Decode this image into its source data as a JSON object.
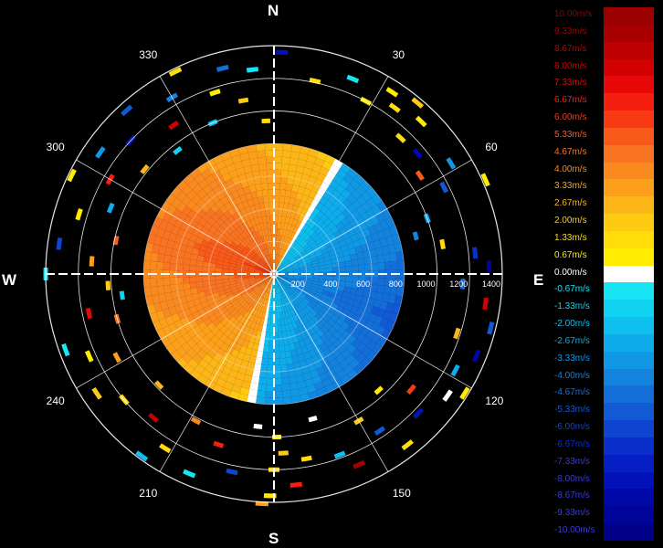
{
  "chart_data": {
    "type": "heatmap",
    "subtype": "polar radial velocity scan",
    "cardinal_labels": {
      "north": "N",
      "east": "E",
      "south": "S",
      "west": "W"
    },
    "bearing_labels": [
      "30",
      "60",
      "120",
      "150",
      "210",
      "240",
      "300",
      "330"
    ],
    "bearing_values": [
      30,
      60,
      120,
      150,
      210,
      240,
      300,
      330
    ],
    "range_labels": [
      "200",
      "400",
      "600",
      "800",
      "1000",
      "1200",
      "1400"
    ],
    "range_values": [
      200,
      400,
      600,
      800,
      1000,
      1200,
      1400
    ],
    "range_max": 1400,
    "colorbar": {
      "unit": "m/s",
      "entries": [
        {
          "label": "10.00m/s",
          "value": 10.0,
          "color": "#9a0000"
        },
        {
          "label": "9.33m/s",
          "value": 9.33,
          "color": "#a80000"
        },
        {
          "label": "8.67m/s",
          "value": 8.67,
          "color": "#bd0000"
        },
        {
          "label": "8.00m/s",
          "value": 8.0,
          "color": "#d20000"
        },
        {
          "label": "7.33m/s",
          "value": 7.33,
          "color": "#e80808"
        },
        {
          "label": "6.67m/s",
          "value": 6.67,
          "color": "#f51f10"
        },
        {
          "label": "6.00m/s",
          "value": 6.0,
          "color": "#f73a14"
        },
        {
          "label": "5.33m/s",
          "value": 5.33,
          "color": "#f85a1a"
        },
        {
          "label": "4.67m/s",
          "value": 4.67,
          "color": "#f97422"
        },
        {
          "label": "4.00m/s",
          "value": 4.0,
          "color": "#fa8a20"
        },
        {
          "label": "3.33m/s",
          "value": 3.33,
          "color": "#fca01c"
        },
        {
          "label": "2.67m/s",
          "value": 2.67,
          "color": "#fdb618"
        },
        {
          "label": "2.00m/s",
          "value": 2.0,
          "color": "#fecb12"
        },
        {
          "label": "1.33m/s",
          "value": 1.33,
          "color": "#ffdc0a"
        },
        {
          "label": "0.67m/s",
          "value": 0.67,
          "color": "#ffec00"
        },
        {
          "label": "0.00m/s",
          "value": 0.0,
          "color": "#ffffff"
        },
        {
          "label": "-0.67m/s",
          "value": -0.67,
          "color": "#17e5f4"
        },
        {
          "label": "-1.33m/s",
          "value": -1.33,
          "color": "#12d2f2"
        },
        {
          "label": "-2.00m/s",
          "value": -2.0,
          "color": "#0fc0ef"
        },
        {
          "label": "-2.67m/s",
          "value": -2.67,
          "color": "#0eacea"
        },
        {
          "label": "-3.33m/s",
          "value": -3.33,
          "color": "#1198e4"
        },
        {
          "label": "-4.00m/s",
          "value": -4.0,
          "color": "#1383de"
        },
        {
          "label": "-4.67m/s",
          "value": -4.67,
          "color": "#146ed8"
        },
        {
          "label": "-5.33m/s",
          "value": -5.33,
          "color": "#1259d4"
        },
        {
          "label": "-6.00m/s",
          "value": -6.0,
          "color": "#0e44d0"
        },
        {
          "label": "-6.67m/s",
          "value": -6.67,
          "color": "#0a30cc"
        },
        {
          "label": "-7.33m/s",
          "value": -7.33,
          "color": "#061fc4"
        },
        {
          "label": "-8.00m/s",
          "value": -8.0,
          "color": "#0212b8"
        },
        {
          "label": "-8.67m/s",
          "value": -8.67,
          "color": "#0008a8"
        },
        {
          "label": "-9.33m/s",
          "value": -9.33,
          "color": "#000498"
        },
        {
          "label": "-10.00m/s",
          "value": -10.0,
          "color": "#000088"
        }
      ]
    },
    "inner_disc": {
      "range_max": 800,
      "zero_line_bearing_north": 30,
      "zero_line_bearing_south": 190,
      "receding_sector_velocity_range": [
        2.0,
        6.0
      ],
      "approaching_sector_velocity_range": [
        -5.33,
        -1.33
      ]
    },
    "scatter_gates": [
      {
        "bearing": 2,
        "range": 1360,
        "velocity": -8.0
      },
      {
        "bearing": 12,
        "range": 1210,
        "velocity": 1.33
      },
      {
        "bearing": 22,
        "range": 1290,
        "velocity": -0.67
      },
      {
        "bearing": 28,
        "range": 1200,
        "velocity": 0.67
      },
      {
        "bearing": 33,
        "range": 1330,
        "velocity": 0.67
      },
      {
        "bearing": 36,
        "range": 1260,
        "velocity": 1.33
      },
      {
        "bearing": 40,
        "range": 1370,
        "velocity": 2.0
      },
      {
        "bearing": 44,
        "range": 1300,
        "velocity": 0.67
      },
      {
        "bearing": 43,
        "range": 1140,
        "velocity": 1.33
      },
      {
        "bearing": 50,
        "range": 1150,
        "velocity": -8.67
      },
      {
        "bearing": 56,
        "range": 1080,
        "velocity": 5.33
      },
      {
        "bearing": 58,
        "range": 1280,
        "velocity": -3.33
      },
      {
        "bearing": 63,
        "range": 1170,
        "velocity": -5.33
      },
      {
        "bearing": 66,
        "range": 1420,
        "velocity": 0.67
      },
      {
        "bearing": 70,
        "range": 1000,
        "velocity": -2.67
      },
      {
        "bearing": 75,
        "range": 900,
        "velocity": -4.0
      },
      {
        "bearing": 80,
        "range": 1050,
        "velocity": 1.33
      },
      {
        "bearing": 84,
        "range": 1240,
        "velocity": -6.67
      },
      {
        "bearing": 88,
        "range": 1320,
        "velocity": -9.33
      },
      {
        "bearing": 93,
        "range": 1160,
        "velocity": -4.67
      },
      {
        "bearing": 98,
        "range": 1310,
        "velocity": 8.0
      },
      {
        "bearing": 104,
        "range": 1370,
        "velocity": -5.33
      },
      {
        "bearing": 108,
        "range": 1180,
        "velocity": 2.67
      },
      {
        "bearing": 112,
        "range": 1340,
        "velocity": -8.67
      },
      {
        "bearing": 118,
        "range": 1260,
        "velocity": -2.67
      },
      {
        "bearing": 122,
        "range": 1380,
        "velocity": 0.67
      },
      {
        "bearing": 125,
        "range": 1300,
        "velocity": 0.0
      },
      {
        "bearing": 130,
        "range": 1100,
        "velocity": 6.0
      },
      {
        "bearing": 134,
        "range": 1230,
        "velocity": -8.0
      },
      {
        "bearing": 138,
        "range": 960,
        "velocity": 0.67
      },
      {
        "bearing": 142,
        "range": 1330,
        "velocity": 1.33
      },
      {
        "bearing": 146,
        "range": 1160,
        "velocity": -5.33
      },
      {
        "bearing": 150,
        "range": 1040,
        "velocity": 2.0
      },
      {
        "bearing": 156,
        "range": 1280,
        "velocity": 9.33
      },
      {
        "bearing": 160,
        "range": 1180,
        "velocity": -2.0
      },
      {
        "bearing": 165,
        "range": 920,
        "velocity": 0.0
      },
      {
        "bearing": 170,
        "range": 1150,
        "velocity": 1.33
      },
      {
        "bearing": 174,
        "range": 1300,
        "velocity": 6.67
      },
      {
        "bearing": 177,
        "range": 1100,
        "velocity": 2.0
      },
      {
        "bearing": 179,
        "range": 1000,
        "velocity": 0.67
      },
      {
        "bearing": 180,
        "range": 1200,
        "velocity": 1.33
      },
      {
        "bearing": 181,
        "range": 1360,
        "velocity": 0.67
      },
      {
        "bearing": 183,
        "range": 1410,
        "velocity": 3.33
      },
      {
        "bearing": 186,
        "range": 940,
        "velocity": 0.0
      },
      {
        "bearing": 192,
        "range": 1240,
        "velocity": -6.0
      },
      {
        "bearing": 198,
        "range": 1100,
        "velocity": 6.67
      },
      {
        "bearing": 203,
        "range": 1330,
        "velocity": -0.67
      },
      {
        "bearing": 208,
        "range": 1020,
        "velocity": 4.0
      },
      {
        "bearing": 212,
        "range": 1260,
        "velocity": 1.33
      },
      {
        "bearing": 216,
        "range": 1380,
        "velocity": -2.0
      },
      {
        "bearing": 220,
        "range": 1150,
        "velocity": 8.67
      },
      {
        "bearing": 226,
        "range": 980,
        "velocity": 2.67
      },
      {
        "bearing": 230,
        "range": 1200,
        "velocity": 1.33
      },
      {
        "bearing": 236,
        "range": 1310,
        "velocity": 2.0
      },
      {
        "bearing": 242,
        "range": 1090,
        "velocity": 3.33
      },
      {
        "bearing": 246,
        "range": 1240,
        "velocity": 0.67
      },
      {
        "bearing": 250,
        "range": 1360,
        "velocity": -0.67
      },
      {
        "bearing": 254,
        "range": 1000,
        "velocity": 4.67
      },
      {
        "bearing": 258,
        "range": 1160,
        "velocity": 7.33
      },
      {
        "bearing": 262,
        "range": 940,
        "velocity": -1.33
      },
      {
        "bearing": 266,
        "range": 1020,
        "velocity": 2.0
      },
      {
        "bearing": 270,
        "range": 1400,
        "velocity": -0.67
      },
      {
        "bearing": 274,
        "range": 1120,
        "velocity": 3.33
      },
      {
        "bearing": 278,
        "range": 1330,
        "velocity": -6.0
      },
      {
        "bearing": 282,
        "range": 990,
        "velocity": 5.33
      },
      {
        "bearing": 287,
        "range": 1250,
        "velocity": 0.67
      },
      {
        "bearing": 292,
        "range": 1080,
        "velocity": -2.67
      },
      {
        "bearing": 296,
        "range": 1380,
        "velocity": 0.67
      },
      {
        "bearing": 300,
        "range": 1160,
        "velocity": 6.67
      },
      {
        "bearing": 305,
        "range": 1300,
        "velocity": -3.33
      },
      {
        "bearing": 309,
        "range": 1020,
        "velocity": 2.67
      },
      {
        "bearing": 313,
        "range": 1200,
        "velocity": -8.0
      },
      {
        "bearing": 318,
        "range": 1350,
        "velocity": -5.33
      },
      {
        "bearing": 322,
        "range": 960,
        "velocity": -1.33
      },
      {
        "bearing": 326,
        "range": 1100,
        "velocity": 8.0
      },
      {
        "bearing": 330,
        "range": 1250,
        "velocity": -4.0
      },
      {
        "bearing": 334,
        "range": 1380,
        "velocity": 1.33
      },
      {
        "bearing": 338,
        "range": 1000,
        "velocity": -2.0
      },
      {
        "bearing": 342,
        "range": 1170,
        "velocity": 0.67
      },
      {
        "bearing": 346,
        "range": 1300,
        "velocity": -4.67
      },
      {
        "bearing": 350,
        "range": 1080,
        "velocity": 2.0
      },
      {
        "bearing": 354,
        "range": 1260,
        "velocity": -0.67
      },
      {
        "bearing": 357,
        "range": 940,
        "velocity": 1.33
      }
    ]
  }
}
